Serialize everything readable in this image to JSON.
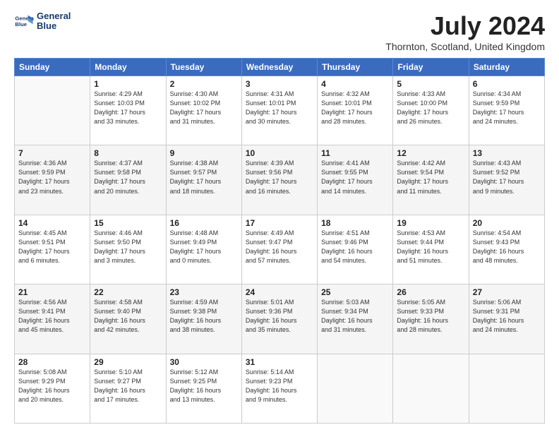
{
  "logo": {
    "line1": "General",
    "line2": "Blue"
  },
  "title": "July 2024",
  "subtitle": "Thornton, Scotland, United Kingdom",
  "days_header": [
    "Sunday",
    "Monday",
    "Tuesday",
    "Wednesday",
    "Thursday",
    "Friday",
    "Saturday"
  ],
  "weeks": [
    [
      {
        "num": "",
        "info": ""
      },
      {
        "num": "1",
        "info": "Sunrise: 4:29 AM\nSunset: 10:03 PM\nDaylight: 17 hours\nand 33 minutes."
      },
      {
        "num": "2",
        "info": "Sunrise: 4:30 AM\nSunset: 10:02 PM\nDaylight: 17 hours\nand 31 minutes."
      },
      {
        "num": "3",
        "info": "Sunrise: 4:31 AM\nSunset: 10:01 PM\nDaylight: 17 hours\nand 30 minutes."
      },
      {
        "num": "4",
        "info": "Sunrise: 4:32 AM\nSunset: 10:01 PM\nDaylight: 17 hours\nand 28 minutes."
      },
      {
        "num": "5",
        "info": "Sunrise: 4:33 AM\nSunset: 10:00 PM\nDaylight: 17 hours\nand 26 minutes."
      },
      {
        "num": "6",
        "info": "Sunrise: 4:34 AM\nSunset: 9:59 PM\nDaylight: 17 hours\nand 24 minutes."
      }
    ],
    [
      {
        "num": "7",
        "info": "Sunrise: 4:36 AM\nSunset: 9:59 PM\nDaylight: 17 hours\nand 23 minutes."
      },
      {
        "num": "8",
        "info": "Sunrise: 4:37 AM\nSunset: 9:58 PM\nDaylight: 17 hours\nand 20 minutes."
      },
      {
        "num": "9",
        "info": "Sunrise: 4:38 AM\nSunset: 9:57 PM\nDaylight: 17 hours\nand 18 minutes."
      },
      {
        "num": "10",
        "info": "Sunrise: 4:39 AM\nSunset: 9:56 PM\nDaylight: 17 hours\nand 16 minutes."
      },
      {
        "num": "11",
        "info": "Sunrise: 4:41 AM\nSunset: 9:55 PM\nDaylight: 17 hours\nand 14 minutes."
      },
      {
        "num": "12",
        "info": "Sunrise: 4:42 AM\nSunset: 9:54 PM\nDaylight: 17 hours\nand 11 minutes."
      },
      {
        "num": "13",
        "info": "Sunrise: 4:43 AM\nSunset: 9:52 PM\nDaylight: 17 hours\nand 9 minutes."
      }
    ],
    [
      {
        "num": "14",
        "info": "Sunrise: 4:45 AM\nSunset: 9:51 PM\nDaylight: 17 hours\nand 6 minutes."
      },
      {
        "num": "15",
        "info": "Sunrise: 4:46 AM\nSunset: 9:50 PM\nDaylight: 17 hours\nand 3 minutes."
      },
      {
        "num": "16",
        "info": "Sunrise: 4:48 AM\nSunset: 9:49 PM\nDaylight: 17 hours\nand 0 minutes."
      },
      {
        "num": "17",
        "info": "Sunrise: 4:49 AM\nSunset: 9:47 PM\nDaylight: 16 hours\nand 57 minutes."
      },
      {
        "num": "18",
        "info": "Sunrise: 4:51 AM\nSunset: 9:46 PM\nDaylight: 16 hours\nand 54 minutes."
      },
      {
        "num": "19",
        "info": "Sunrise: 4:53 AM\nSunset: 9:44 PM\nDaylight: 16 hours\nand 51 minutes."
      },
      {
        "num": "20",
        "info": "Sunrise: 4:54 AM\nSunset: 9:43 PM\nDaylight: 16 hours\nand 48 minutes."
      }
    ],
    [
      {
        "num": "21",
        "info": "Sunrise: 4:56 AM\nSunset: 9:41 PM\nDaylight: 16 hours\nand 45 minutes."
      },
      {
        "num": "22",
        "info": "Sunrise: 4:58 AM\nSunset: 9:40 PM\nDaylight: 16 hours\nand 42 minutes."
      },
      {
        "num": "23",
        "info": "Sunrise: 4:59 AM\nSunset: 9:38 PM\nDaylight: 16 hours\nand 38 minutes."
      },
      {
        "num": "24",
        "info": "Sunrise: 5:01 AM\nSunset: 9:36 PM\nDaylight: 16 hours\nand 35 minutes."
      },
      {
        "num": "25",
        "info": "Sunrise: 5:03 AM\nSunset: 9:34 PM\nDaylight: 16 hours\nand 31 minutes."
      },
      {
        "num": "26",
        "info": "Sunrise: 5:05 AM\nSunset: 9:33 PM\nDaylight: 16 hours\nand 28 minutes."
      },
      {
        "num": "27",
        "info": "Sunrise: 5:06 AM\nSunset: 9:31 PM\nDaylight: 16 hours\nand 24 minutes."
      }
    ],
    [
      {
        "num": "28",
        "info": "Sunrise: 5:08 AM\nSunset: 9:29 PM\nDaylight: 16 hours\nand 20 minutes."
      },
      {
        "num": "29",
        "info": "Sunrise: 5:10 AM\nSunset: 9:27 PM\nDaylight: 16 hours\nand 17 minutes."
      },
      {
        "num": "30",
        "info": "Sunrise: 5:12 AM\nSunset: 9:25 PM\nDaylight: 16 hours\nand 13 minutes."
      },
      {
        "num": "31",
        "info": "Sunrise: 5:14 AM\nSunset: 9:23 PM\nDaylight: 16 hours\nand 9 minutes."
      },
      {
        "num": "",
        "info": ""
      },
      {
        "num": "",
        "info": ""
      },
      {
        "num": "",
        "info": ""
      }
    ]
  ]
}
